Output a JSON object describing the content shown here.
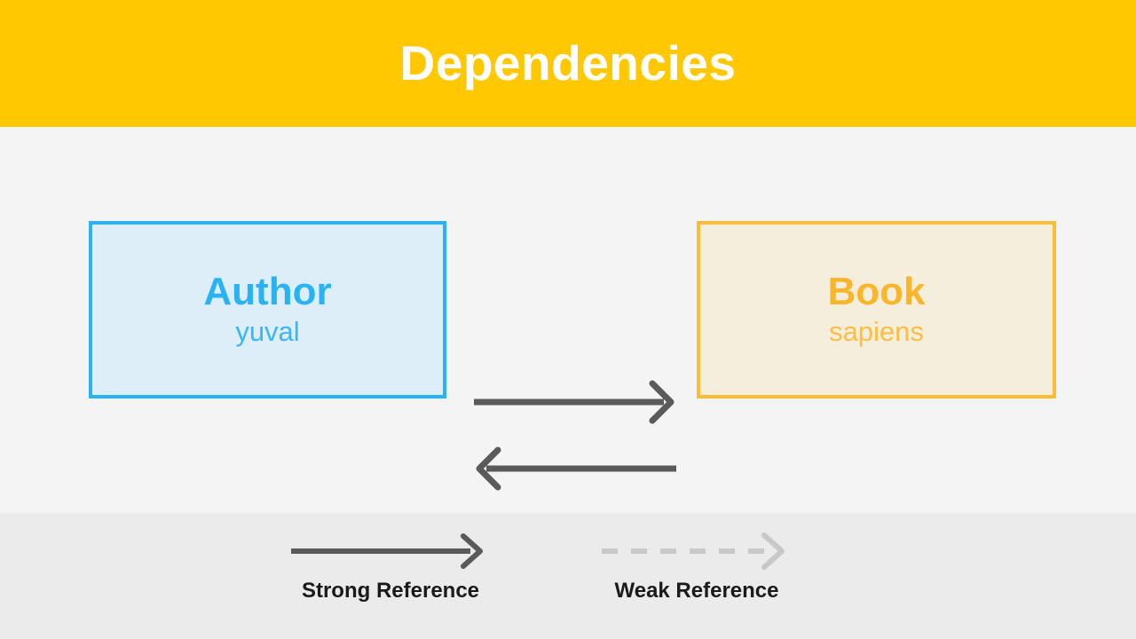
{
  "slide": {
    "title": "Dependencies",
    "background_color": "#f4f4f4",
    "title_bar_color": "#ffc800",
    "title_text_color": "#ffffff"
  },
  "diagram": {
    "nodes": [
      {
        "id": "author",
        "title": "Author",
        "subtitle": "yuval",
        "fill_color": "#ddeef9",
        "border_color": "#29b2f4",
        "text_color": "#29b2f4"
      },
      {
        "id": "book",
        "title": "Book",
        "subtitle": "sapiens",
        "fill_color": "#f5eedc",
        "border_color": "#fabd35",
        "text_color": "#fbb528"
      }
    ],
    "edges": [
      {
        "id": "author-to-book",
        "from": "author",
        "to": "book",
        "direction": "right",
        "style": "solid",
        "reference_type": "Strong Reference",
        "color": "#5a5a5a"
      },
      {
        "id": "book-to-author",
        "from": "book",
        "to": "author",
        "direction": "left",
        "style": "solid",
        "reference_type": "Strong Reference",
        "color": "#5a5a5a"
      }
    ]
  },
  "legend": {
    "background_color": "#ebebeb",
    "items": [
      {
        "id": "strong",
        "label": "Strong Reference",
        "style": "solid",
        "color": "#5a5a5a"
      },
      {
        "id": "weak",
        "label": "Weak Reference",
        "style": "dashed",
        "color": "#c8c8c8"
      }
    ]
  }
}
